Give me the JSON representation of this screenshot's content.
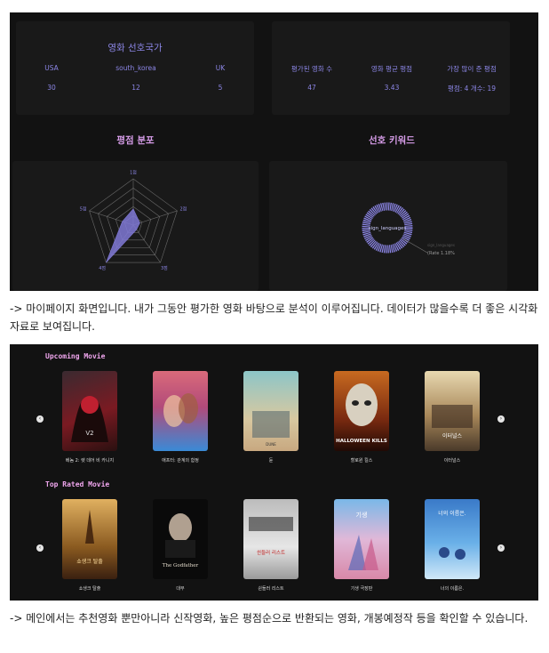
{
  "mypage": {
    "countries": {
      "title": "영화 선호국가",
      "items": [
        {
          "label": "USA",
          "value": "30"
        },
        {
          "label": "south_korea",
          "value": "12"
        },
        {
          "label": "UK",
          "value": "5"
        }
      ]
    },
    "stats": {
      "items": [
        {
          "label": "평가된 영화 수",
          "value": "47"
        },
        {
          "label": "영화 평균 평점",
          "value": "3.43"
        },
        {
          "label": "가장 많이 준 평점",
          "value": "평점: 4 개수: 19"
        }
      ]
    },
    "rating_title": "평점 분포",
    "keyword_title": "선호 키워드",
    "radar": {
      "axes": [
        "1점",
        "2점",
        "3점",
        "4점",
        "5점"
      ],
      "values": [
        0.35,
        0.15,
        0.12,
        1.0,
        0.25
      ],
      "color": "#8079d6"
    },
    "keyword": {
      "center_label": "sign_languages",
      "tooltip_line1": "sign_languages",
      "tooltip_line2": "(Rate 1.18%"
    }
  },
  "caption1": "-> 마이페이지 화면입니다. 내가 그동안 평가한 영화 바탕으로 분석이 이루어집니다. 데이터가 많을수록 더 좋은 시각화자료로 보여집니다.",
  "main": {
    "upcoming_title": "Upcoming Movie",
    "top_rated_title": "Top Rated Movie",
    "upcoming": [
      {
        "title": "베놈 2: 렛 데어 비 카니지",
        "icon": "venom-poster"
      },
      {
        "title": "애프터: 관계의 함정",
        "icon": "after-poster"
      },
      {
        "title": "듄",
        "icon": "dune-poster",
        "text": "DUNE"
      },
      {
        "title": "할로윈 킬스",
        "icon": "halloween-poster",
        "text": "HALLOWEEN KILLS"
      },
      {
        "title": "이터널스",
        "icon": "eternals-poster",
        "text": "이터널스"
      }
    ],
    "top_rated": [
      {
        "title": "쇼생크 탈출",
        "icon": "shawshank-poster",
        "text": "쇼생크 탈출"
      },
      {
        "title": "대부",
        "icon": "godfather-poster",
        "text": "The Godfather"
      },
      {
        "title": "쉰들러 리스트",
        "icon": "schindler-poster",
        "text": "쉰들러 리스트"
      },
      {
        "title": "기생 극장판",
        "icon": "parasite-anime-poster",
        "text": "기생"
      },
      {
        "title": "너의 이름은.",
        "icon": "your-name-poster",
        "text": "너의 이름은."
      }
    ]
  },
  "caption2": "-> 메인에서는 추천영화 뿐만아니라 신작영화, 높은 평점순으로 반환되는 영화, 개봉예정작 등을 확인할 수 있습니다."
}
